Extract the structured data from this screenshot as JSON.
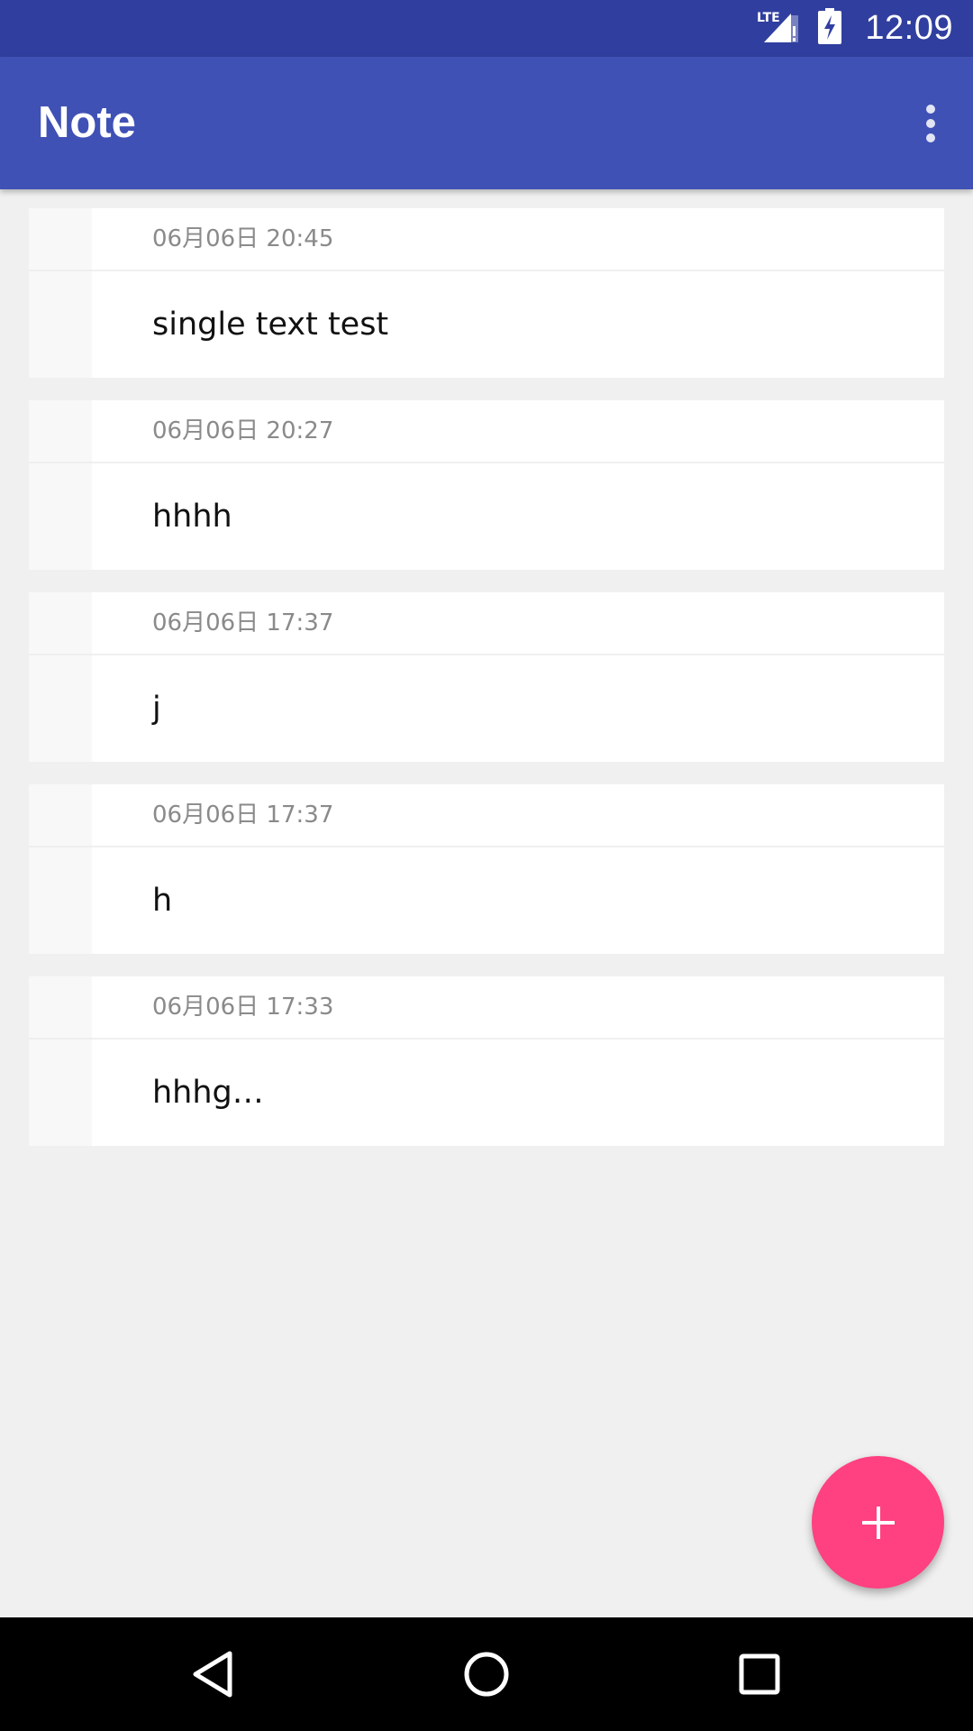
{
  "status_bar": {
    "network_label": "LTE",
    "time": "12:09"
  },
  "app_bar": {
    "title": "Note",
    "overflow_icon": "more-vert-icon"
  },
  "notes": [
    {
      "date": "06月06日 20:45",
      "text": "single text test"
    },
    {
      "date": "06月06日 20:27",
      "text": "hhhh"
    },
    {
      "date": "06月06日 17:37",
      "text": "j"
    },
    {
      "date": "06月06日 17:37",
      "text": "h"
    },
    {
      "date": "06月06日 17:33",
      "text": "hhhg…"
    }
  ],
  "fab": {
    "icon": "plus-icon",
    "color": "#ff4081"
  },
  "colors": {
    "primary": "#3f51b5",
    "primary_dark": "#303f9f",
    "background": "#f0f0f0"
  },
  "nav_bar": {
    "back_icon": "back-triangle-icon",
    "home_icon": "home-circle-icon",
    "recents_icon": "recents-square-icon"
  }
}
